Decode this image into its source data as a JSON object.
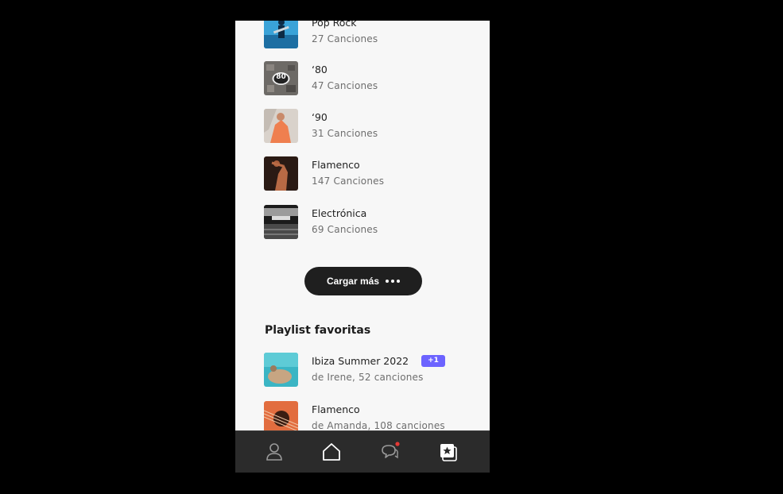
{
  "genres": [
    {
      "title": "Pop Rock",
      "subtitle": "27 Canciones",
      "icon": "pop-rock-cover"
    },
    {
      "title": "‘80",
      "subtitle": "47 Canciones",
      "icon": "eighties-cover",
      "badge_text": "80"
    },
    {
      "title": "‘90",
      "subtitle": "31 Canciones",
      "icon": "nineties-cover"
    },
    {
      "title": "Flamenco",
      "subtitle": "147 Canciones",
      "icon": "flamenco-cover"
    },
    {
      "title": "Electrónica",
      "subtitle": "69 Canciones",
      "icon": "electronica-cover"
    }
  ],
  "load_more": {
    "label": "Cargar más"
  },
  "favorites": {
    "section_title": "Playlist favoritas",
    "items": [
      {
        "title": "Ibiza Summer 2022",
        "subtitle": "de Irene, 52 canciones",
        "badge": "+1",
        "icon": "ibiza-cover"
      },
      {
        "title": "Flamenco",
        "subtitle": "de Amanda, 108 canciones",
        "icon": "guitar-cover"
      }
    ]
  },
  "nav": {
    "items": [
      "profile-icon",
      "home-icon",
      "chat-icon",
      "favorites-icon"
    ],
    "active": "favorites-icon",
    "notification_color": "#e53935"
  },
  "colors": {
    "accent": "#6c63ff",
    "background": "#f7f7f7",
    "nav": "#2b2b2b",
    "button": "#1f1f1f"
  }
}
